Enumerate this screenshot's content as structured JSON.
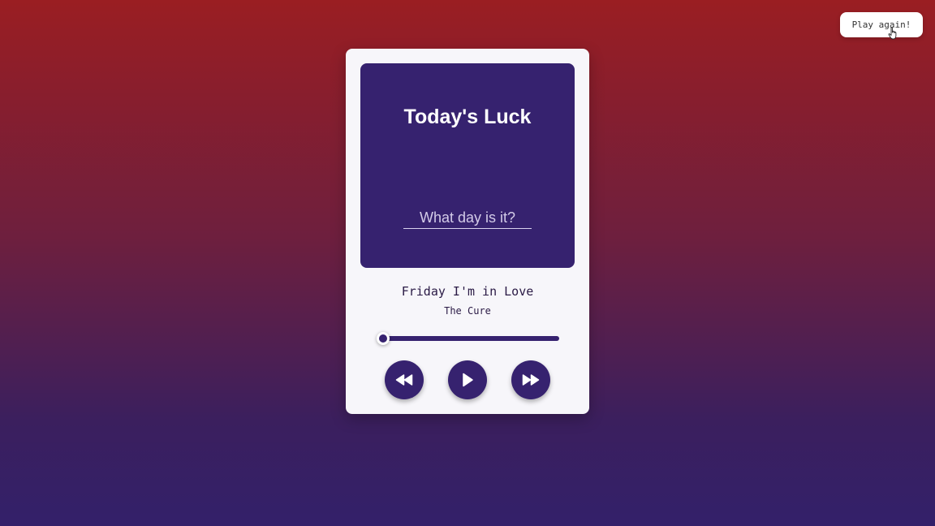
{
  "top_button": {
    "label": "Play again!"
  },
  "player": {
    "art_title": "Today's Luck",
    "day_input_placeholder": "What day is it?",
    "day_input_value": "",
    "song_title": "Friday I'm in Love",
    "artist": "The Cure",
    "progress": 0.0,
    "controls": {
      "rewind_icon": "rewind-icon",
      "play_icon": "play-icon",
      "forward_icon": "fast-forward-icon"
    }
  },
  "colors": {
    "accent": "#36226f",
    "card_background": "#f7f6fa",
    "text_dark": "#2a1a45"
  }
}
